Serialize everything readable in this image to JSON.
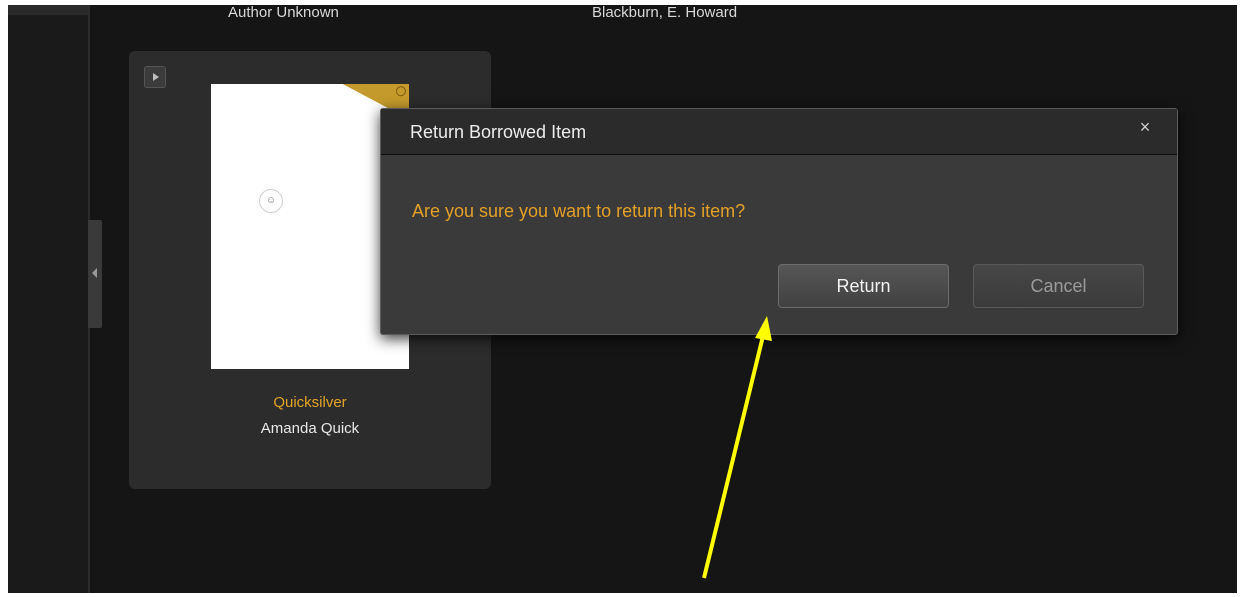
{
  "library": {
    "top_authors": [
      "Author Unknown",
      "Blackburn, E. Howard"
    ],
    "book": {
      "title": "Quicksilver",
      "author": "Amanda Quick"
    }
  },
  "dialog": {
    "title": "Return Borrowed Item",
    "message": "Are you sure you want to return this item?",
    "return_label": "Return",
    "cancel_label": "Cancel",
    "close_label": "×"
  },
  "colors": {
    "background": "#151515",
    "accent": "#e2a426",
    "annotation_arrow": "#ffff00"
  },
  "icons": [
    "play-icon",
    "collapse-arrow-icon",
    "close-icon",
    "ribbon-icon"
  ]
}
